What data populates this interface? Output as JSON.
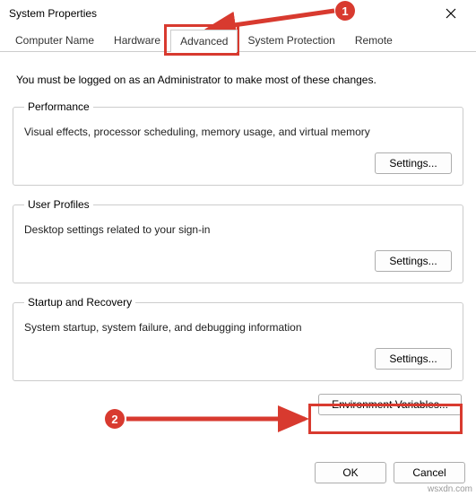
{
  "window": {
    "title": "System Properties"
  },
  "tabs": {
    "t0": "Computer Name",
    "t1": "Hardware",
    "t2": "Advanced",
    "t3": "System Protection",
    "t4": "Remote"
  },
  "notice": "You must be logged on as an Administrator to make most of these changes.",
  "groups": {
    "performance": {
      "legend": "Performance",
      "desc": "Visual effects, processor scheduling, memory usage, and virtual memory",
      "button": "Settings..."
    },
    "userprofiles": {
      "legend": "User Profiles",
      "desc": "Desktop settings related to your sign-in",
      "button": "Settings..."
    },
    "startup": {
      "legend": "Startup and Recovery",
      "desc": "System startup, system failure, and debugging information",
      "button": "Settings..."
    }
  },
  "env_button": "Environment Variables...",
  "footer": {
    "ok": "OK",
    "cancel": "Cancel"
  },
  "annotations": {
    "badge1": "1",
    "badge2": "2"
  },
  "watermark": "wsxdn.com"
}
